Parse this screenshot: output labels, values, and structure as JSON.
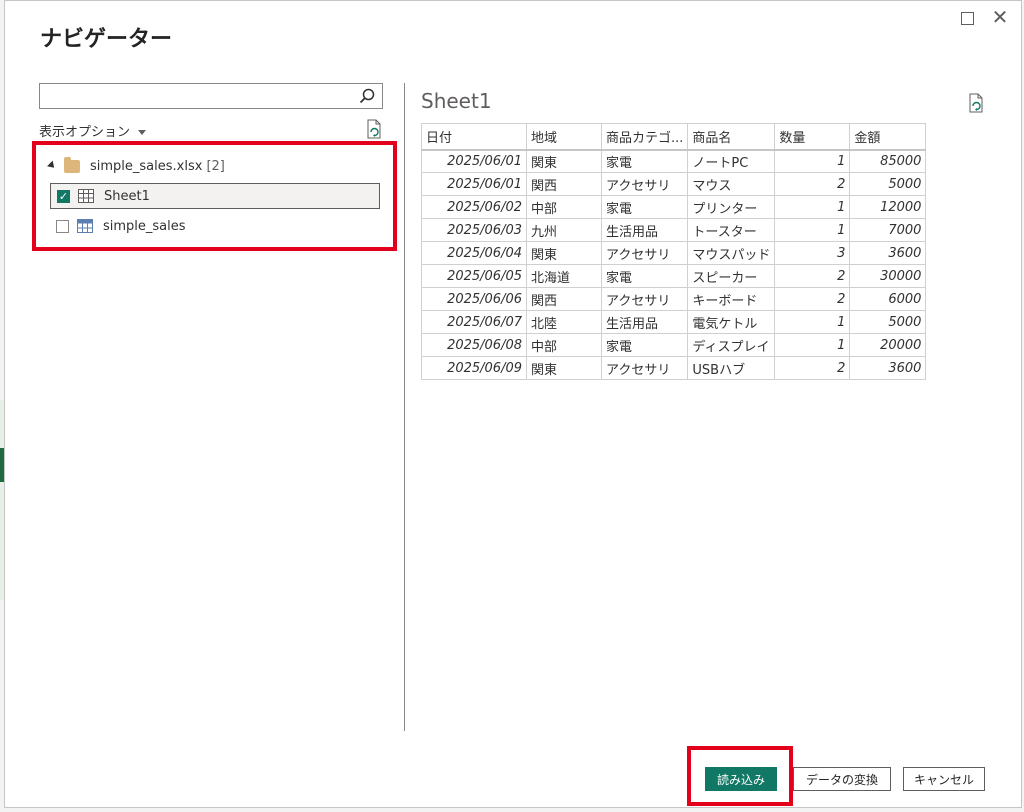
{
  "dialog": {
    "title": "ナビゲーター"
  },
  "left_pane": {
    "search_value": "",
    "display_options_label": "表示オプション",
    "tree": {
      "root_file": "simple_sales.xlsx",
      "root_count": "[2]",
      "items": [
        {
          "label": "Sheet1",
          "checked": true,
          "selected": true,
          "icon": "sheet-icon"
        },
        {
          "label": "simple_sales",
          "checked": false,
          "selected": false,
          "icon": "table-icon"
        }
      ]
    }
  },
  "preview": {
    "title": "Sheet1",
    "columns": [
      "日付",
      "地域",
      "商品カテゴ...",
      "商品名",
      "数量",
      "金額"
    ],
    "rows": [
      [
        "2025/06/01",
        "関東",
        "家電",
        "ノートPC",
        "1",
        "85000"
      ],
      [
        "2025/06/01",
        "関西",
        "アクセサリ",
        "マウス",
        "2",
        "5000"
      ],
      [
        "2025/06/02",
        "中部",
        "家電",
        "プリンター",
        "1",
        "12000"
      ],
      [
        "2025/06/03",
        "九州",
        "生活用品",
        "トースター",
        "1",
        "7000"
      ],
      [
        "2025/06/04",
        "関東",
        "アクセサリ",
        "マウスパッド",
        "3",
        "3600"
      ],
      [
        "2025/06/05",
        "北海道",
        "家電",
        "スピーカー",
        "2",
        "30000"
      ],
      [
        "2025/06/06",
        "関西",
        "アクセサリ",
        "キーボード",
        "2",
        "6000"
      ],
      [
        "2025/06/07",
        "北陸",
        "生活用品",
        "電気ケトル",
        "1",
        "5000"
      ],
      [
        "2025/06/08",
        "中部",
        "家電",
        "ディスプレイ",
        "1",
        "20000"
      ],
      [
        "2025/06/09",
        "関東",
        "アクセサリ",
        "USBハブ",
        "2",
        "3600"
      ]
    ]
  },
  "footer": {
    "load_label": "読み込み",
    "transform_label": "データの変換",
    "cancel_label": "キャンセル"
  },
  "colors": {
    "accent": "#117865",
    "highlight": "#e3001b",
    "folder": "#dcb67a"
  }
}
